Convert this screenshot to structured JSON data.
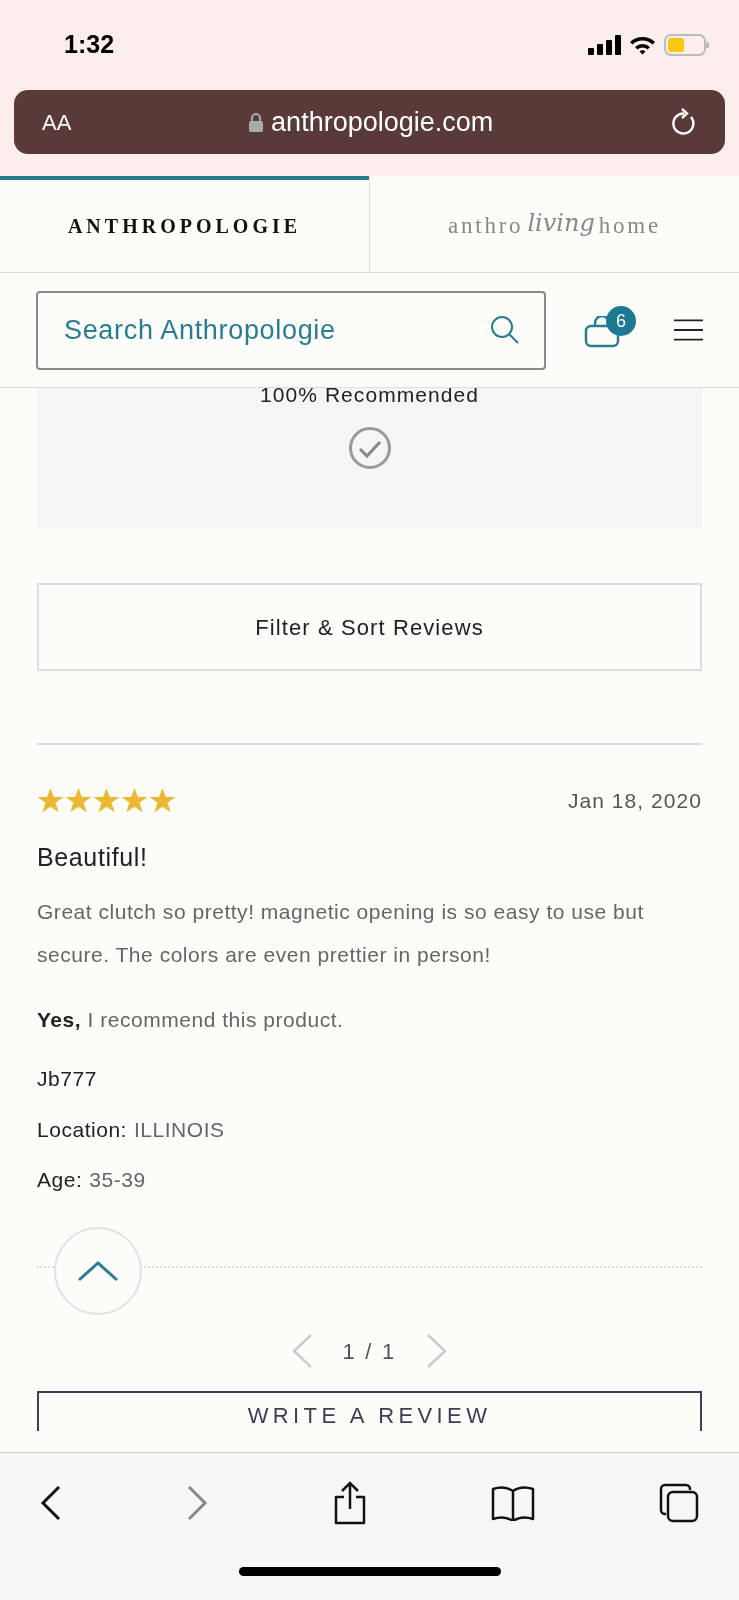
{
  "status_bar": {
    "time": "1:32"
  },
  "url_bar": {
    "text_size": "AA",
    "url": "anthropologie.com"
  },
  "brand_tabs": [
    {
      "kind": "plain",
      "parts": [
        "ANTHROPOLOGIE"
      ],
      "selected": true
    },
    {
      "kind": "script",
      "parts": [
        "anthro",
        "living",
        "home"
      ],
      "selected": false
    }
  ],
  "search": {
    "placeholder": "Search Anthropologie"
  },
  "cart": {
    "count": "6"
  },
  "summary": {
    "text": "100% Recommended"
  },
  "filter_button": "Filter & Sort Reviews",
  "review": {
    "stars": 5,
    "date": "Jan 18, 2020",
    "title": "Beautiful!",
    "body": "Great clutch so pretty! magnetic opening is so easy to use but secure. The colors are even prettier in person!",
    "recommend": "**Yes,** I recommend this product.",
    "author": "Jb777",
    "fields": [
      {
        "label": "Location:",
        "value": "ILLINOIS"
      },
      {
        "label": "Age:",
        "value": "35-39"
      }
    ]
  },
  "pager": {
    "text": "1 / 1",
    "prev_disabled": true,
    "next_disabled": true
  },
  "write_button": "WRITE A REVIEW"
}
